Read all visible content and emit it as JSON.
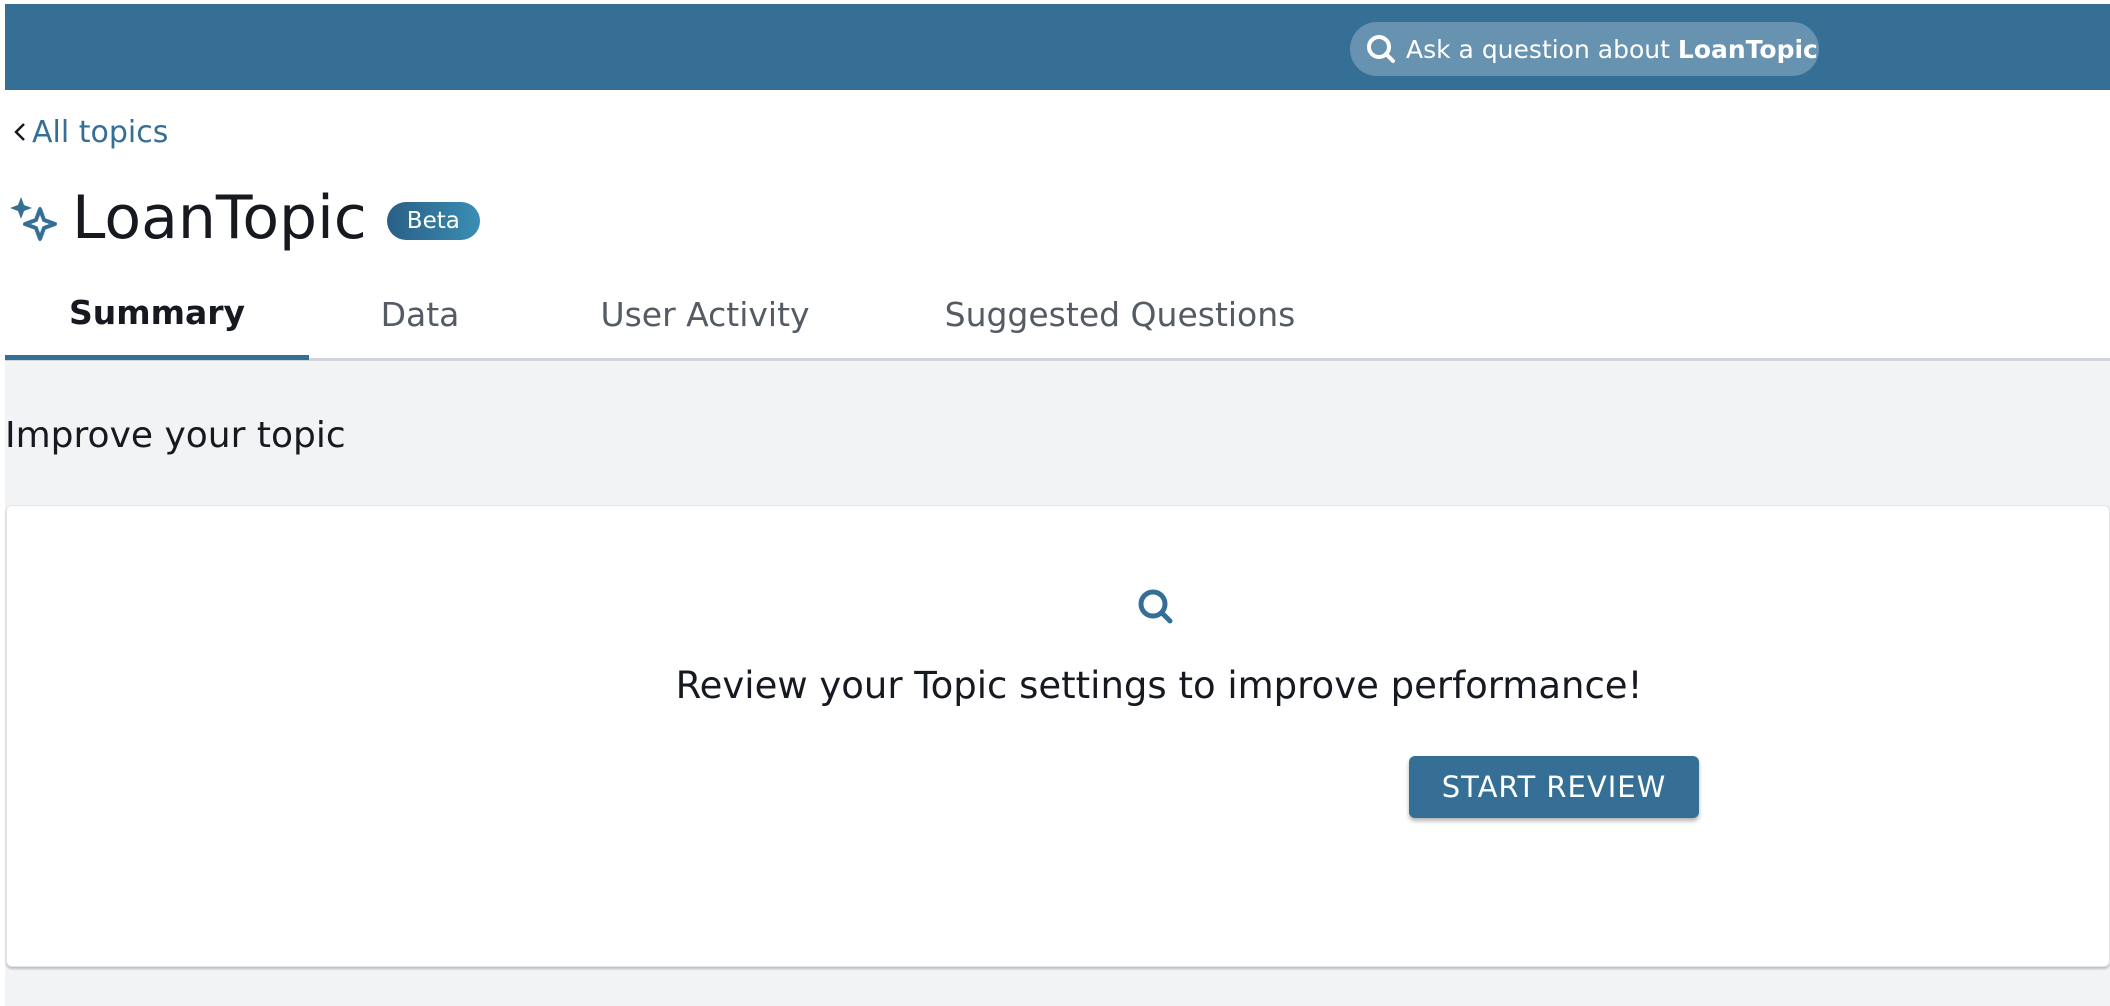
{
  "header": {
    "ask_prefix": "Ask a question about",
    "ask_topic": "LoanTopic",
    "search_icon": "search-icon"
  },
  "nav": {
    "back_label": "All topics",
    "back_icon": "chevron-left-icon"
  },
  "topic": {
    "icon": "sparkle-icon",
    "title": "LoanTopic",
    "badge": "Beta"
  },
  "tabs": [
    {
      "label": "Summary",
      "active": true
    },
    {
      "label": "Data",
      "active": false
    },
    {
      "label": "User Activity",
      "active": false
    },
    {
      "label": "Suggested Questions",
      "active": false
    }
  ],
  "improve": {
    "heading": "Improve your topic",
    "card_icon": "search-icon",
    "message": "Review your Topic settings to improve performance!",
    "button_label": "START REVIEW"
  },
  "colors": {
    "brand": "#366f96",
    "page_bg": "#f2f3f4"
  }
}
